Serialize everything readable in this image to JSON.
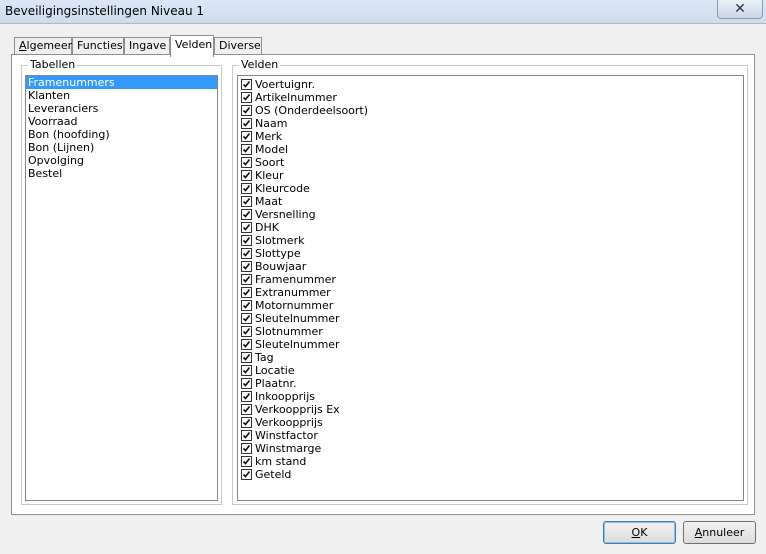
{
  "window": {
    "title": "Beveiligingsinstellingen Niveau 1"
  },
  "tabs": [
    {
      "label_u": "A",
      "label_rest": "lgemeen",
      "active": false
    },
    {
      "label_u": "",
      "label_rest": "Functies",
      "active": false
    },
    {
      "label_u": "",
      "label_rest": "Ingave",
      "active": false
    },
    {
      "label_u": "",
      "label_rest": "Velden",
      "active": true
    },
    {
      "label_u": "",
      "label_rest": "Diverse",
      "active": false
    }
  ],
  "tabellen": {
    "label": "Tabellen",
    "items": [
      "Framenummers",
      "Klanten",
      "Leveranciers",
      "Voorraad",
      "Bon (hoofding)",
      "Bon (Lijnen)",
      "Opvolging",
      "Bestel"
    ],
    "selected_index": 0
  },
  "velden": {
    "label": "Velden",
    "items": [
      {
        "label": "Voertuignr.",
        "checked": true
      },
      {
        "label": "Artikelnummer",
        "checked": true
      },
      {
        "label": "OS (Onderdeelsoort)",
        "checked": true
      },
      {
        "label": "Naam",
        "checked": true
      },
      {
        "label": "Merk",
        "checked": true
      },
      {
        "label": "Model",
        "checked": true
      },
      {
        "label": "Soort",
        "checked": true
      },
      {
        "label": "Kleur",
        "checked": true
      },
      {
        "label": "Kleurcode",
        "checked": true
      },
      {
        "label": "Maat",
        "checked": true
      },
      {
        "label": "Versnelling",
        "checked": true
      },
      {
        "label": "DHK",
        "checked": true
      },
      {
        "label": "Slotmerk",
        "checked": true
      },
      {
        "label": "Slottype",
        "checked": true
      },
      {
        "label": "Bouwjaar",
        "checked": true
      },
      {
        "label": "Framenummer",
        "checked": true
      },
      {
        "label": "Extranummer",
        "checked": true
      },
      {
        "label": "Motornummer",
        "checked": true
      },
      {
        "label": "Sleutelnummer",
        "checked": true
      },
      {
        "label": "Slotnummer",
        "checked": true
      },
      {
        "label": "Sleutelnummer",
        "checked": true
      },
      {
        "label": "Tag",
        "checked": true
      },
      {
        "label": "Locatie",
        "checked": true
      },
      {
        "label": "Plaatnr.",
        "checked": true
      },
      {
        "label": "Inkoopprijs",
        "checked": true
      },
      {
        "label": "Verkoopprijs Ex",
        "checked": true
      },
      {
        "label": "Verkoopprijs",
        "checked": true
      },
      {
        "label": "Winstfactor",
        "checked": true
      },
      {
        "label": "Winstmarge",
        "checked": true
      },
      {
        "label": "km stand",
        "checked": true
      },
      {
        "label": "Geteld",
        "checked": true
      }
    ]
  },
  "buttons": {
    "ok_u": "O",
    "ok_rest": "K",
    "cancel_u": "A",
    "cancel_rest": "nnuleer"
  }
}
